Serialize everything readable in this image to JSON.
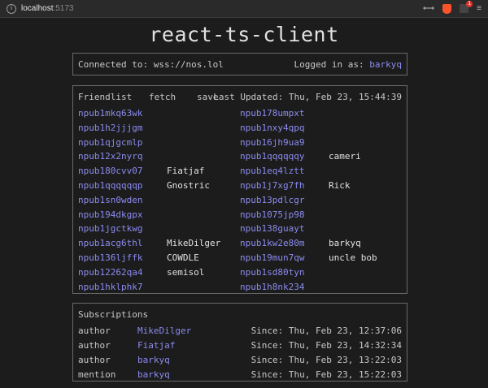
{
  "browser": {
    "host": "localhost",
    "port": ":5173",
    "rewards_badge": "1"
  },
  "app": {
    "title": "react-ts-client"
  },
  "connection": {
    "connected_label": "Connected to: ",
    "relay": "wss://nos.lol",
    "logged_label": "Logged in as: ",
    "user": "barkyq"
  },
  "friendlist": {
    "title": "Friendlist",
    "fetch_label": "fetch",
    "save_label": "save",
    "last_updated": "Last Updated: Thu, Feb 23, 15:44:39",
    "col1": [
      {
        "npub": "npub1mkq63wk",
        "name": ""
      },
      {
        "npub": "npub1h2jjjgm",
        "name": ""
      },
      {
        "npub": "npub1qjgcmlp",
        "name": ""
      },
      {
        "npub": "npub12x2nyrq",
        "name": ""
      },
      {
        "npub": "npub180cvv07",
        "name": "Fiatjaf"
      },
      {
        "npub": "npub1qqqqqqp",
        "name": "Gnostric"
      },
      {
        "npub": "npub1sn0wden",
        "name": ""
      },
      {
        "npub": "npub194dkgpx",
        "name": ""
      },
      {
        "npub": "npub1jgctkwg",
        "name": ""
      },
      {
        "npub": "npub1acg6thl",
        "name": "MikeDilger"
      },
      {
        "npub": "npub136ljffk",
        "name": "COWDLE"
      },
      {
        "npub": "npub12262qa4",
        "name": "semisol"
      },
      {
        "npub": "npub1hklphk7",
        "name": ""
      }
    ],
    "col2": [
      {
        "npub": "npub178umpxt",
        "name": ""
      },
      {
        "npub": "npub1nxy4qpq",
        "name": ""
      },
      {
        "npub": "npub16jh9ua9",
        "name": ""
      },
      {
        "npub": "npub1qqqqqqy",
        "name": "cameri"
      },
      {
        "npub": "npub1eq4lztt",
        "name": ""
      },
      {
        "npub": "npub1j7xg7fh",
        "name": "Rick"
      },
      {
        "npub": "npub13pdlcgr",
        "name": ""
      },
      {
        "npub": "npub1075jp98",
        "name": ""
      },
      {
        "npub": "npub138guayt",
        "name": ""
      },
      {
        "npub": "npub1kw2e80m",
        "name": "barkyq"
      },
      {
        "npub": "npub19mun7qw",
        "name": "uncle bob"
      },
      {
        "npub": "npub1sd80tyn",
        "name": ""
      },
      {
        "npub": "npub1h8nk234",
        "name": ""
      }
    ]
  },
  "subscriptions": {
    "title": "Subscriptions",
    "rows": [
      {
        "type": "author",
        "name": "MikeDilger",
        "since": "Since: Thu, Feb 23, 12:37:06"
      },
      {
        "type": "author",
        "name": "Fiatjaf",
        "since": "Since: Thu, Feb 23, 14:32:34"
      },
      {
        "type": "author",
        "name": "barkyq",
        "since": "Since: Thu, Feb 23, 13:22:03"
      },
      {
        "type": "mention",
        "name": "barkyq",
        "since": "Since: Thu, Feb 23, 15:22:03"
      }
    ]
  }
}
